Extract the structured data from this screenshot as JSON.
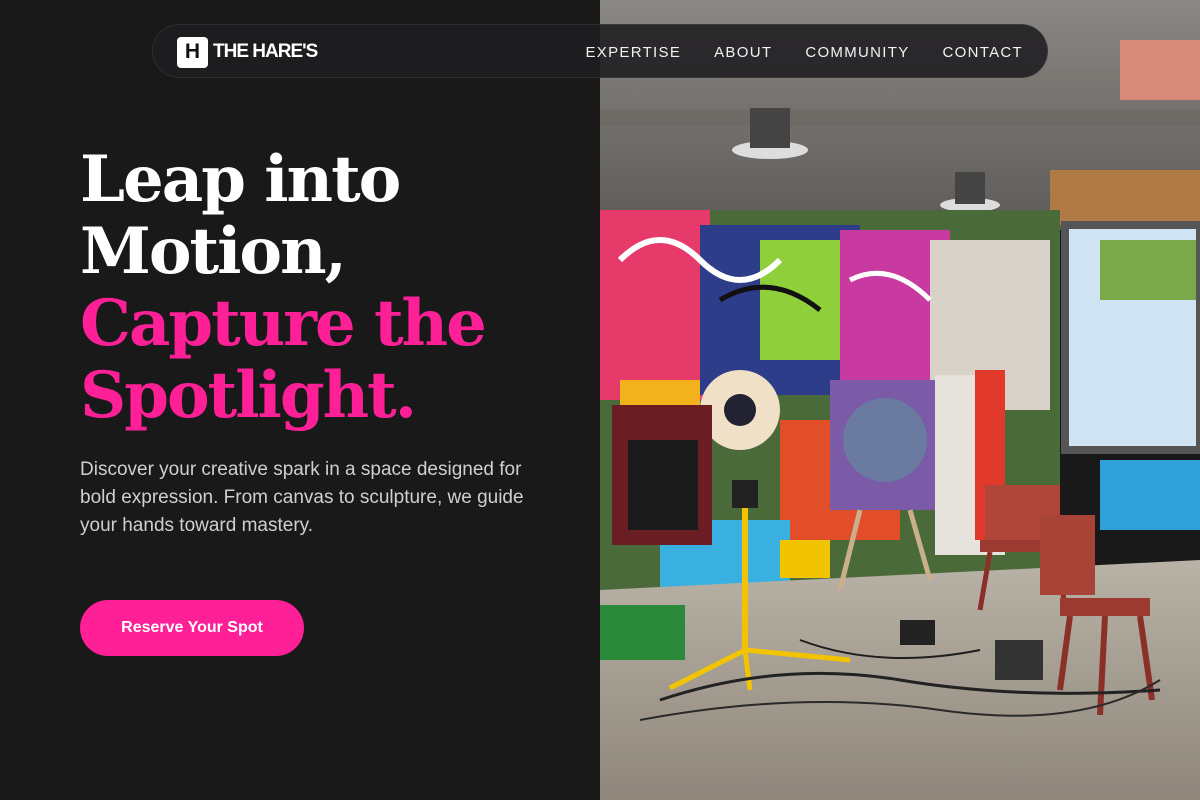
{
  "brand": {
    "mark": "H",
    "name": "THE HARE'S"
  },
  "nav": {
    "links": [
      "EXPERTISE",
      "ABOUT",
      "COMMUNITY",
      "CONTACT"
    ]
  },
  "hero": {
    "headline_line1": "Leap into",
    "headline_line2": "Motion,",
    "headline_line3": "Capture the",
    "headline_line4": "Spotlight.",
    "description": "Discover your creative spark in a space designed for bold expression. From canvas to sculpture, we guide your hands toward mastery.",
    "cta_label": "Reserve Your Spot"
  },
  "photo": {
    "subject": "graffiti art studio with easels, chairs, tripod light and cables"
  },
  "colors": {
    "background": "#1a191a",
    "accent": "#ff1f96",
    "text": "#ffffff",
    "muted": "#cfcfcf"
  }
}
